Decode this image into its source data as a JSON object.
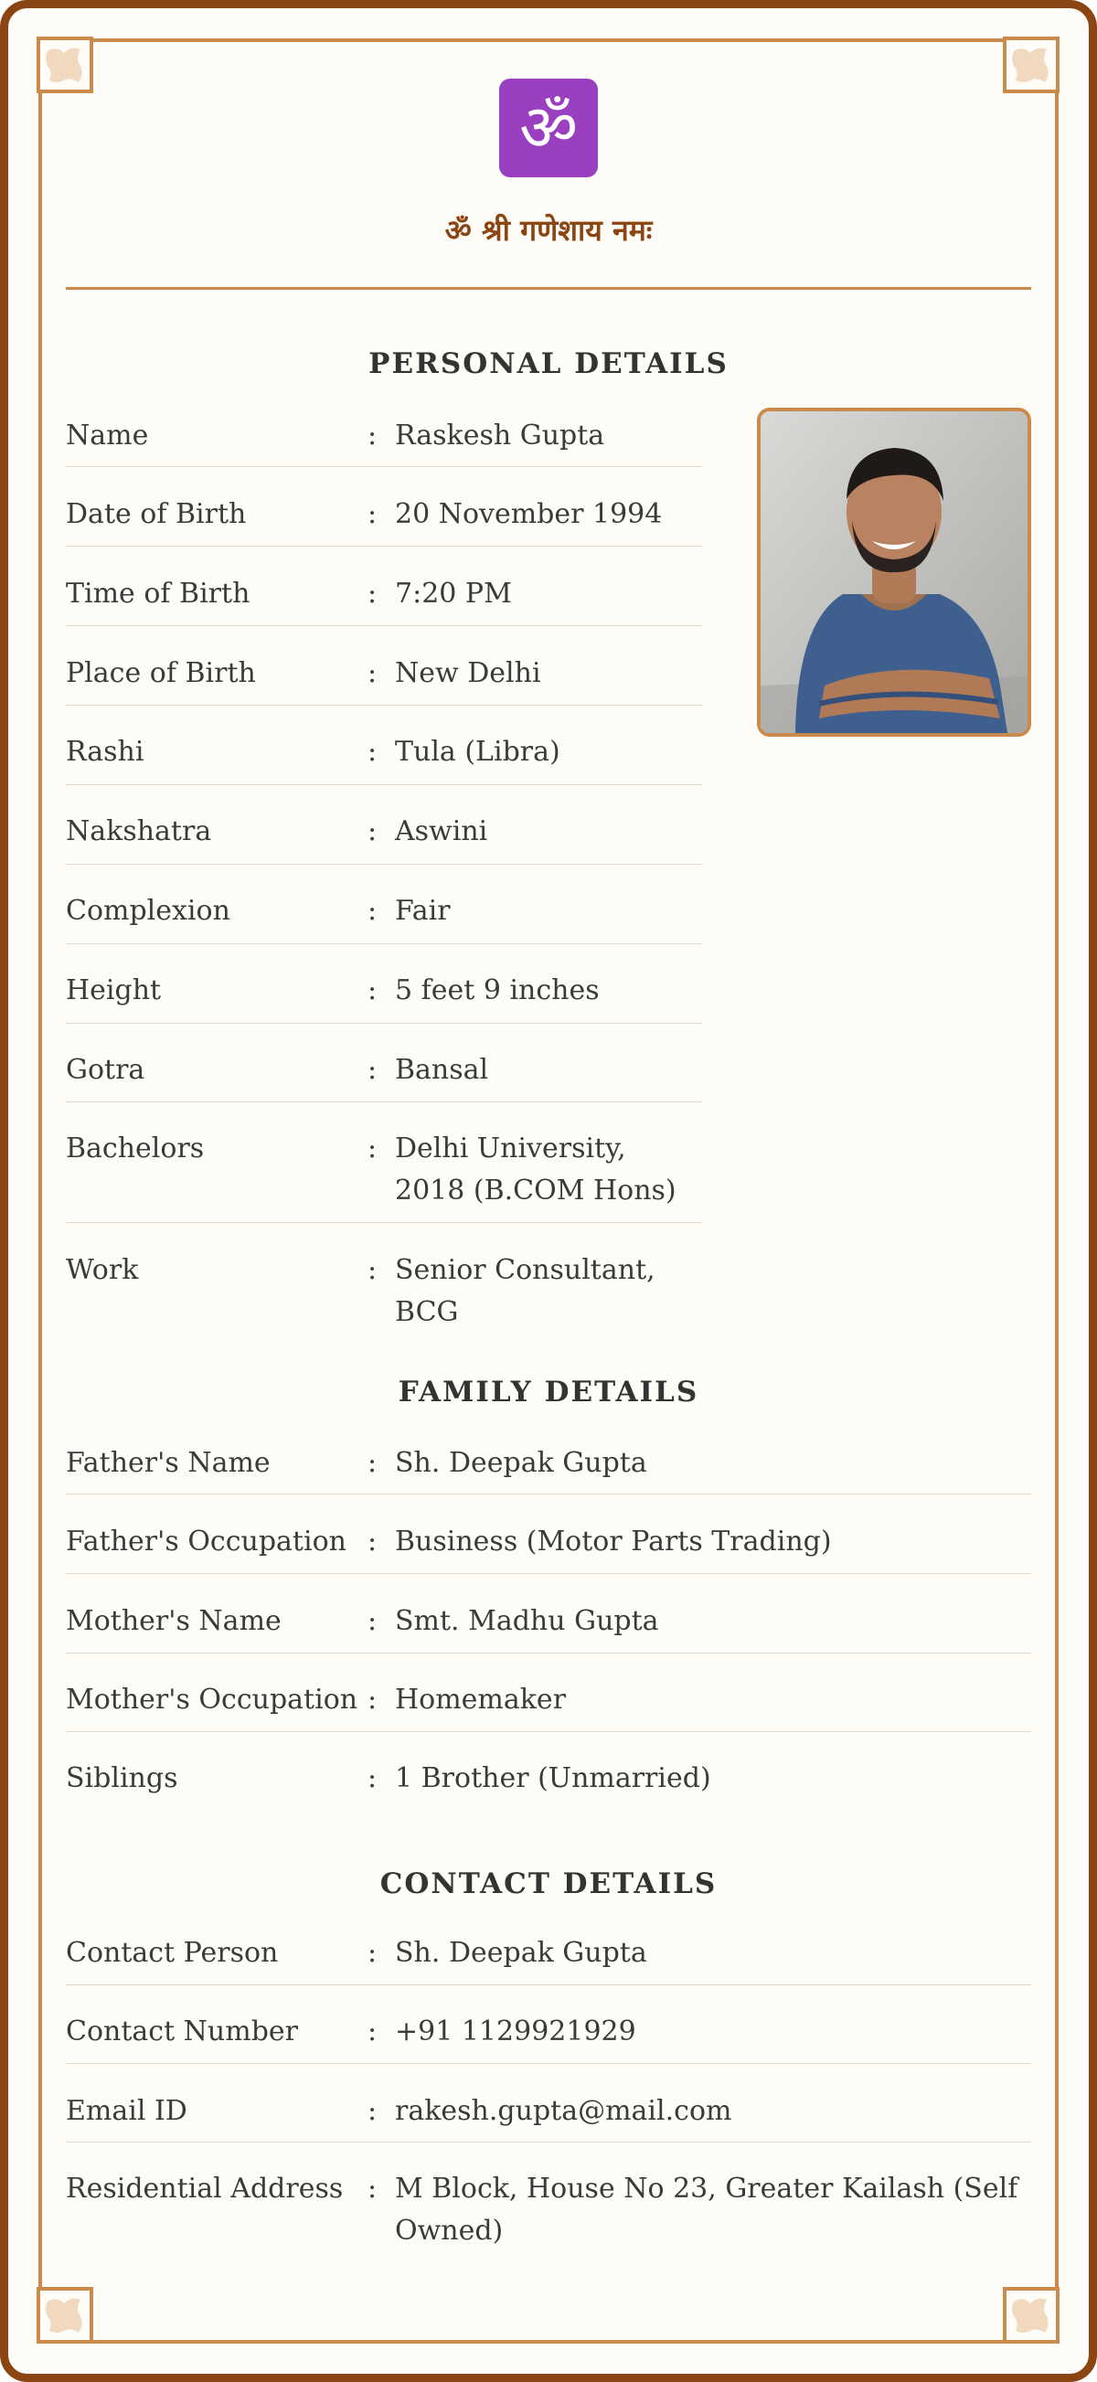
{
  "header": {
    "om_symbol": "ॐ",
    "mantra": "ॐ श्री गणेशाय नमः",
    "om_icon": "om-icon"
  },
  "personal": {
    "title": "PERSONAL DETAILS",
    "rows": [
      {
        "label": "Name",
        "value": "Raskesh Gupta"
      },
      {
        "label": "Date of Birth",
        "value": "20 November 1994"
      },
      {
        "label": "Time of Birth",
        "value": "7:20 PM"
      },
      {
        "label": "Place of Birth",
        "value": "New Delhi"
      },
      {
        "label": "Rashi",
        "value": "Tula (Libra)"
      },
      {
        "label": "Nakshatra",
        "value": "Aswini"
      },
      {
        "label": "Complexion",
        "value": "Fair"
      },
      {
        "label": "Height",
        "value": "5 feet 9 inches"
      },
      {
        "label": "Gotra",
        "value": "Bansal"
      },
      {
        "label": "Bachelors",
        "value": "Delhi University, 2018 (B.COM Hons)"
      },
      {
        "label": "Work",
        "value": "Senior Consultant, BCG"
      }
    ]
  },
  "family": {
    "title": "FAMILY DETAILS",
    "rows": [
      {
        "label": "Father's Name",
        "value": "Sh. Deepak Gupta"
      },
      {
        "label": "Father's Occupation",
        "value": "Business (Motor Parts Trading)"
      },
      {
        "label": "Mother's Name",
        "value": "Smt. Madhu Gupta"
      },
      {
        "label": "Mother's Occupation",
        "value": "Homemaker"
      },
      {
        "label": "Siblings",
        "value": "1 Brother (Unmarried)"
      }
    ]
  },
  "contact": {
    "title": "CONTACT DETAILS",
    "rows": [
      {
        "label": "Contact Person",
        "value": "Sh. Deepak Gupta"
      },
      {
        "label": "Contact Number",
        "value": "+91 1129921929"
      },
      {
        "label": "Email ID",
        "value": "rakesh.gupta@mail.com"
      },
      {
        "label": "Residential Address",
        "value": "M Block, House No 23, Greater Kailash (Self Owned)"
      }
    ]
  },
  "separator": ":",
  "colors": {
    "frame": "#8b4513",
    "accent": "#c98a4b",
    "paper": "#fdfcf7",
    "om_background": "#9a3fbf"
  }
}
